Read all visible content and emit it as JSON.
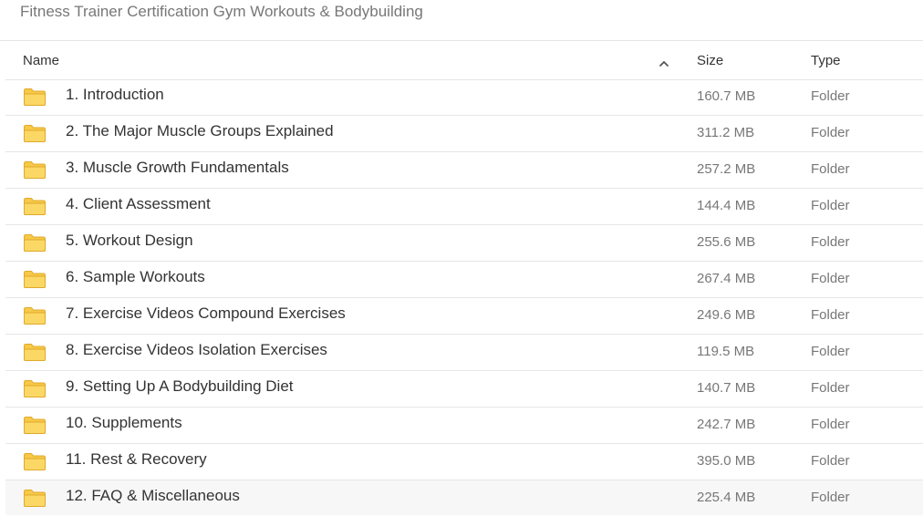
{
  "breadcrumb": "Fitness Trainer Certification Gym Workouts & Bodybuilding",
  "table": {
    "headers": {
      "name": "Name",
      "size": "Size",
      "type": "Type"
    },
    "sort_icon": "chevron-up-icon",
    "folder_color": "#f7c948",
    "rows": [
      {
        "name": "1. Introduction",
        "size": "160.7 MB",
        "type": "Folder"
      },
      {
        "name": "2. The Major Muscle Groups Explained",
        "size": "311.2 MB",
        "type": "Folder"
      },
      {
        "name": "3. Muscle Growth Fundamentals",
        "size": "257.2 MB",
        "type": "Folder"
      },
      {
        "name": "4. Client Assessment",
        "size": "144.4 MB",
        "type": "Folder"
      },
      {
        "name": "5. Workout Design",
        "size": "255.6 MB",
        "type": "Folder"
      },
      {
        "name": "6. Sample Workouts",
        "size": "267.4 MB",
        "type": "Folder"
      },
      {
        "name": "7. Exercise Videos Compound Exercises",
        "size": "249.6 MB",
        "type": "Folder"
      },
      {
        "name": "8. Exercise Videos Isolation Exercises",
        "size": "119.5 MB",
        "type": "Folder"
      },
      {
        "name": "9. Setting Up A Bodybuilding Diet",
        "size": "140.7 MB",
        "type": "Folder"
      },
      {
        "name": "10. Supplements",
        "size": "242.7 MB",
        "type": "Folder"
      },
      {
        "name": "11. Rest & Recovery",
        "size": "395.0 MB",
        "type": "Folder"
      },
      {
        "name": "12. FAQ & Miscellaneous",
        "size": "225.4 MB",
        "type": "Folder"
      }
    ]
  }
}
